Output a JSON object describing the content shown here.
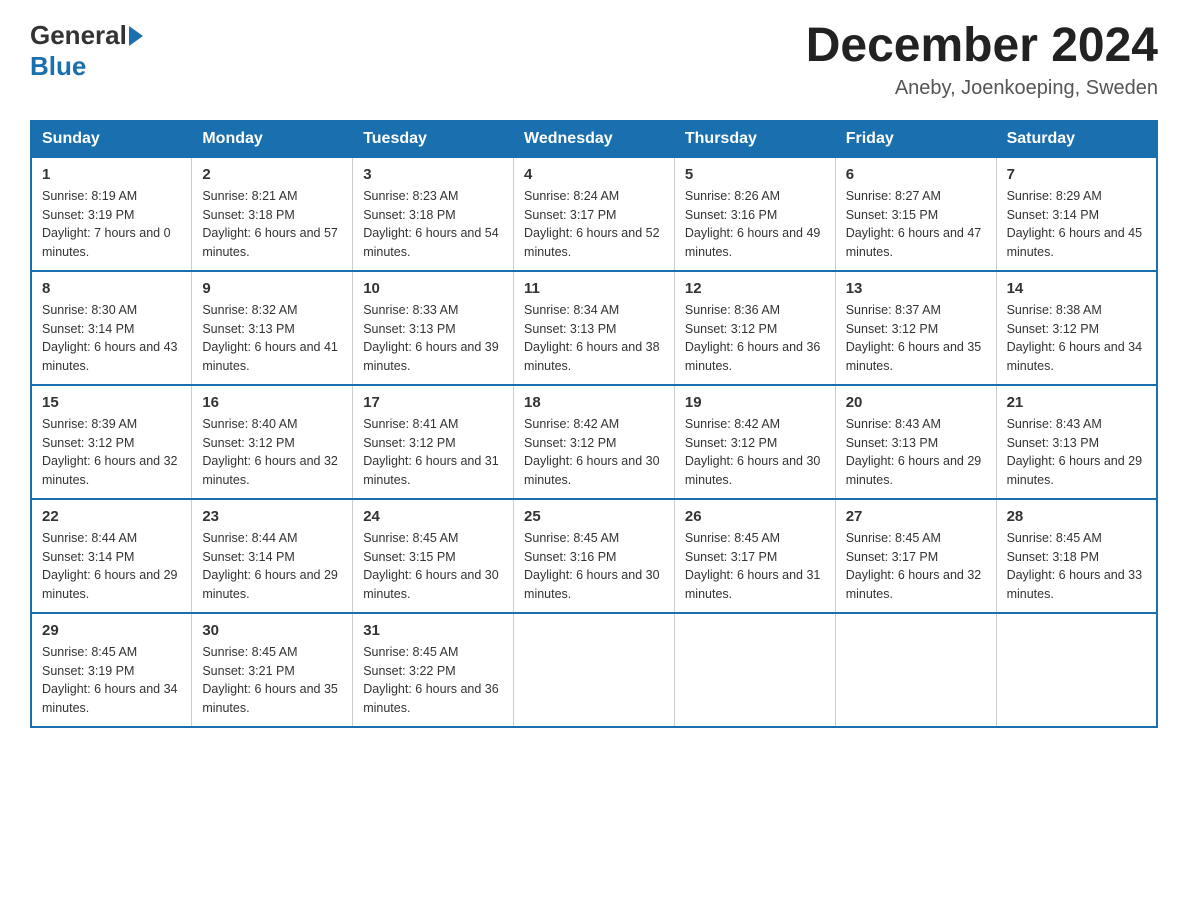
{
  "header": {
    "logo_general": "General",
    "logo_blue": "Blue",
    "title": "December 2024",
    "location": "Aneby, Joenkoeping, Sweden"
  },
  "days_of_week": [
    "Sunday",
    "Monday",
    "Tuesday",
    "Wednesday",
    "Thursday",
    "Friday",
    "Saturday"
  ],
  "weeks": [
    [
      {
        "day": "1",
        "sunrise": "8:19 AM",
        "sunset": "3:19 PM",
        "daylight": "7 hours and 0 minutes."
      },
      {
        "day": "2",
        "sunrise": "8:21 AM",
        "sunset": "3:18 PM",
        "daylight": "6 hours and 57 minutes."
      },
      {
        "day": "3",
        "sunrise": "8:23 AM",
        "sunset": "3:18 PM",
        "daylight": "6 hours and 54 minutes."
      },
      {
        "day": "4",
        "sunrise": "8:24 AM",
        "sunset": "3:17 PM",
        "daylight": "6 hours and 52 minutes."
      },
      {
        "day": "5",
        "sunrise": "8:26 AM",
        "sunset": "3:16 PM",
        "daylight": "6 hours and 49 minutes."
      },
      {
        "day": "6",
        "sunrise": "8:27 AM",
        "sunset": "3:15 PM",
        "daylight": "6 hours and 47 minutes."
      },
      {
        "day": "7",
        "sunrise": "8:29 AM",
        "sunset": "3:14 PM",
        "daylight": "6 hours and 45 minutes."
      }
    ],
    [
      {
        "day": "8",
        "sunrise": "8:30 AM",
        "sunset": "3:14 PM",
        "daylight": "6 hours and 43 minutes."
      },
      {
        "day": "9",
        "sunrise": "8:32 AM",
        "sunset": "3:13 PM",
        "daylight": "6 hours and 41 minutes."
      },
      {
        "day": "10",
        "sunrise": "8:33 AM",
        "sunset": "3:13 PM",
        "daylight": "6 hours and 39 minutes."
      },
      {
        "day": "11",
        "sunrise": "8:34 AM",
        "sunset": "3:13 PM",
        "daylight": "6 hours and 38 minutes."
      },
      {
        "day": "12",
        "sunrise": "8:36 AM",
        "sunset": "3:12 PM",
        "daylight": "6 hours and 36 minutes."
      },
      {
        "day": "13",
        "sunrise": "8:37 AM",
        "sunset": "3:12 PM",
        "daylight": "6 hours and 35 minutes."
      },
      {
        "day": "14",
        "sunrise": "8:38 AM",
        "sunset": "3:12 PM",
        "daylight": "6 hours and 34 minutes."
      }
    ],
    [
      {
        "day": "15",
        "sunrise": "8:39 AM",
        "sunset": "3:12 PM",
        "daylight": "6 hours and 32 minutes."
      },
      {
        "day": "16",
        "sunrise": "8:40 AM",
        "sunset": "3:12 PM",
        "daylight": "6 hours and 32 minutes."
      },
      {
        "day": "17",
        "sunrise": "8:41 AM",
        "sunset": "3:12 PM",
        "daylight": "6 hours and 31 minutes."
      },
      {
        "day": "18",
        "sunrise": "8:42 AM",
        "sunset": "3:12 PM",
        "daylight": "6 hours and 30 minutes."
      },
      {
        "day": "19",
        "sunrise": "8:42 AM",
        "sunset": "3:12 PM",
        "daylight": "6 hours and 30 minutes."
      },
      {
        "day": "20",
        "sunrise": "8:43 AM",
        "sunset": "3:13 PM",
        "daylight": "6 hours and 29 minutes."
      },
      {
        "day": "21",
        "sunrise": "8:43 AM",
        "sunset": "3:13 PM",
        "daylight": "6 hours and 29 minutes."
      }
    ],
    [
      {
        "day": "22",
        "sunrise": "8:44 AM",
        "sunset": "3:14 PM",
        "daylight": "6 hours and 29 minutes."
      },
      {
        "day": "23",
        "sunrise": "8:44 AM",
        "sunset": "3:14 PM",
        "daylight": "6 hours and 29 minutes."
      },
      {
        "day": "24",
        "sunrise": "8:45 AM",
        "sunset": "3:15 PM",
        "daylight": "6 hours and 30 minutes."
      },
      {
        "day": "25",
        "sunrise": "8:45 AM",
        "sunset": "3:16 PM",
        "daylight": "6 hours and 30 minutes."
      },
      {
        "day": "26",
        "sunrise": "8:45 AM",
        "sunset": "3:17 PM",
        "daylight": "6 hours and 31 minutes."
      },
      {
        "day": "27",
        "sunrise": "8:45 AM",
        "sunset": "3:17 PM",
        "daylight": "6 hours and 32 minutes."
      },
      {
        "day": "28",
        "sunrise": "8:45 AM",
        "sunset": "3:18 PM",
        "daylight": "6 hours and 33 minutes."
      }
    ],
    [
      {
        "day": "29",
        "sunrise": "8:45 AM",
        "sunset": "3:19 PM",
        "daylight": "6 hours and 34 minutes."
      },
      {
        "day": "30",
        "sunrise": "8:45 AM",
        "sunset": "3:21 PM",
        "daylight": "6 hours and 35 minutes."
      },
      {
        "day": "31",
        "sunrise": "8:45 AM",
        "sunset": "3:22 PM",
        "daylight": "6 hours and 36 minutes."
      },
      null,
      null,
      null,
      null
    ]
  ],
  "labels": {
    "sunrise": "Sunrise:",
    "sunset": "Sunset:",
    "daylight": "Daylight:"
  }
}
